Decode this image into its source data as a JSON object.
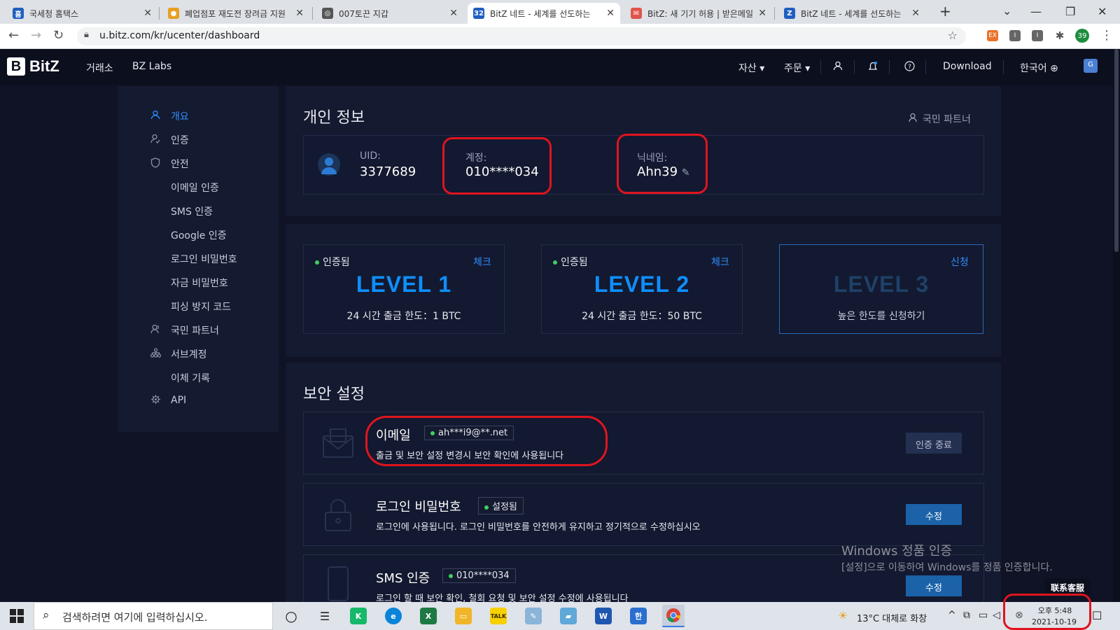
{
  "browser": {
    "tabs": [
      {
        "title": "국세청 홈택스",
        "fav": "홈",
        "color": "#1f5fbf"
      },
      {
        "title": "폐업점포 재도전 장려금 지원",
        "fav": "●",
        "color": "#e8a020"
      },
      {
        "title": "007토끈 지갑",
        "fav": "◎",
        "color": "#555555"
      },
      {
        "title": "BitZ 네트 - 세계를 선도하는",
        "fav": "32",
        "color": "#1f5fbf"
      },
      {
        "title": "BitZ: 새 기기 허용 | 받은메일",
        "fav": "✉",
        "color": "#e0534a"
      },
      {
        "title": "BitZ 네트 - 세계를 선도하는",
        "fav": "Z",
        "color": "#1f5fbf"
      }
    ],
    "new_tab": "+",
    "url": "u.bitz.com/kr/ucenter/dashboard",
    "profile_badge": "39"
  },
  "header": {
    "logo_mark": "B",
    "logo_text": "BitZ",
    "nav": [
      "거래소",
      "BZ Labs"
    ],
    "assets": "자산 ▾",
    "orders": "주문 ▾",
    "download": "Download",
    "language": "한국어"
  },
  "sidebar": {
    "items": [
      {
        "label": "개요",
        "icon": "user-icon"
      },
      {
        "label": "인증",
        "icon": "id-icon"
      },
      {
        "label": "안전",
        "icon": "shield-icon"
      },
      {
        "label": "이메일 인증",
        "icon": ""
      },
      {
        "label": "SMS 인증",
        "icon": ""
      },
      {
        "label": "Google 인증",
        "icon": ""
      },
      {
        "label": "로그인 비밀번호",
        "icon": ""
      },
      {
        "label": "자금 비밀번호",
        "icon": ""
      },
      {
        "label": "피싱 방지 코드",
        "icon": ""
      },
      {
        "label": "국민 파트너",
        "icon": "partner-icon"
      },
      {
        "label": "서브계정",
        "icon": "hierarchy-icon"
      },
      {
        "label": "이체 기록",
        "icon": ""
      },
      {
        "label": "API",
        "icon": "api-icon"
      }
    ]
  },
  "personal": {
    "title": "개인 정보",
    "partner_link": "국민 파트너",
    "uid_label": "UID:",
    "uid": "3377689",
    "account_label": "계정:",
    "account": "010****034",
    "nick_label": "닉네임:",
    "nick": "Ahn39"
  },
  "levels": [
    {
      "status": "인증됨",
      "action": "체크",
      "name": "LEVEL 1",
      "desc": "24 시간 출금 한도：1 BTC"
    },
    {
      "status": "인증됨",
      "action": "체크",
      "name": "LEVEL 2",
      "desc": "24 시간 출금 한도：50 BTC"
    },
    {
      "status": "",
      "action": "신청",
      "name": "LEVEL 3",
      "desc": "높은 한도를 신청하기"
    }
  ],
  "security": {
    "title": "보안 설정",
    "rows": [
      {
        "title": "이메일",
        "badge": "ah***i9@**.net",
        "desc": "출금 및 보안 설정 변경시 보안 확인에 사용됩니다",
        "button": "인증 중료"
      },
      {
        "title": "로그인 비밀번호",
        "badge": "설정됨",
        "desc": "로그인에 사용됩니다. 로그인 비밀번호를 안전하게 유지하고 정기적으로 수정하십시오",
        "button": "수정"
      },
      {
        "title": "SMS 인증",
        "badge": "010****034",
        "desc": "로그인 할 때 보안 확인, 철회 요청 및 보안 설정 수정에 사용됩니다",
        "button": "수정"
      }
    ]
  },
  "watermark": {
    "line1": "Windows 정품 인증",
    "line2": "[설정]으로 이동하여 Windows를 정품 인증합니다."
  },
  "support_button": "联系客服",
  "taskbar": {
    "search_placeholder": "검색하려면 여기에 입력하십시오.",
    "weather": "13°C  대체로 화창",
    "time": "오후 5:48",
    "date": "2021-10-19"
  }
}
